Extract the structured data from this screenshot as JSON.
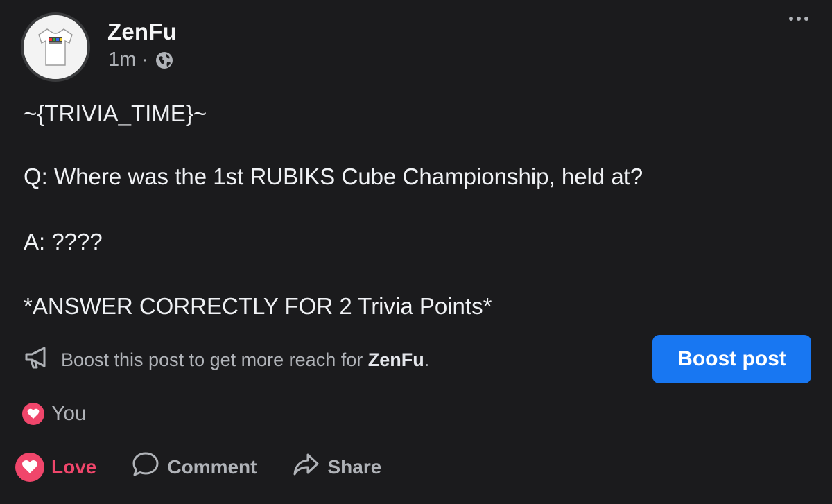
{
  "post": {
    "author": "ZenFu",
    "time": "1m",
    "separator": "·",
    "visibility_icon": "globe-icon",
    "menu_icon": "more-options-icon",
    "lines": [
      "~{TRIVIA_TIME}~",
      "Q: Where was the 1st RUBIKS Cube Championship, held at?",
      "A: ????",
      "*ANSWER CORRECTLY FOR 2 Trivia Points*"
    ]
  },
  "boost": {
    "text_prefix": "Boost this post to get more reach for ",
    "text_name": "ZenFu",
    "text_suffix": ".",
    "button_label": "Boost post",
    "icon": "megaphone-icon",
    "button_color": "#1877f2"
  },
  "reactions": {
    "icon": "heart-icon",
    "label": "You",
    "color": "#f0466b"
  },
  "actions": {
    "love_label": "Love",
    "comment_label": "Comment",
    "share_label": "Share"
  }
}
